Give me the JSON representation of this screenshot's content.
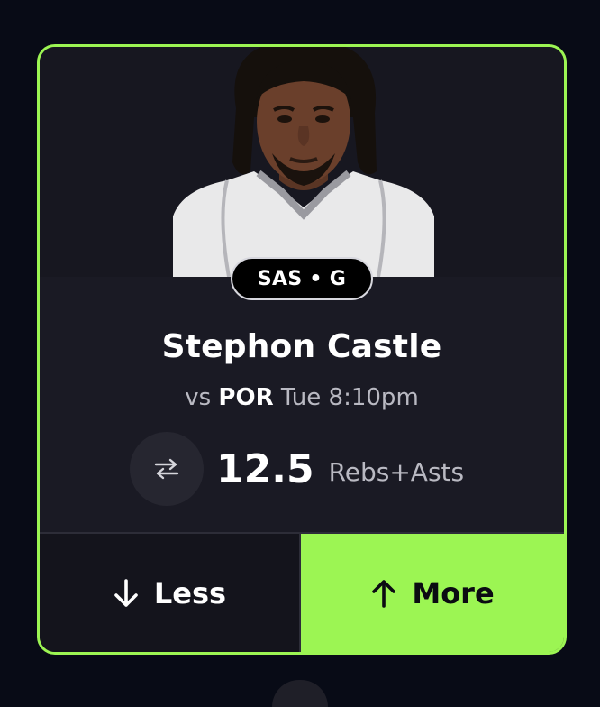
{
  "player": {
    "badge": "SAS • G",
    "name": "Stephon Castle",
    "matchup_prefix": "vs",
    "opponent": "POR",
    "game_time": "Tue 8:10pm"
  },
  "projection": {
    "line": "12.5",
    "stat_type": "Rebs+Asts"
  },
  "actions": {
    "less_label": "Less",
    "more_label": "More"
  },
  "colors": {
    "accent": "#9cf553",
    "background": "#080b16",
    "card": "#14141e"
  },
  "icons": {
    "swap": "swap-arrows-icon",
    "less": "arrow-down-icon",
    "more": "arrow-up-icon"
  }
}
